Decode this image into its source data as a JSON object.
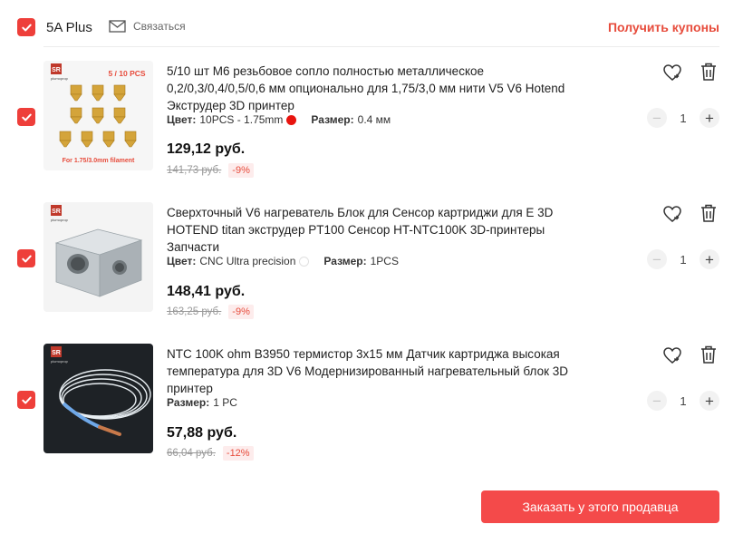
{
  "header": {
    "store_name": "5A Plus",
    "contact_label": "Связаться",
    "coupons_label": "Получить купоны"
  },
  "items": [
    {
      "title": "5/10 шт M6 резьбовое сопло полностью металлическое 0,2/0,3/0,4/0,5/0,6 мм опционально для 1,75/3,0 мм нити V5 V6 Hotend Экструдер 3D принтер",
      "color_label": "Цвет:",
      "color_value": "10PCS - 1.75mm",
      "color_swatch": "#e8140f",
      "size_label": "Размер:",
      "size_value": "0.4 мм",
      "price": "129,12 руб.",
      "old_price": "141,73 руб.",
      "discount": "-9%",
      "quantity": "1",
      "image_badge": "5 / 10 PCS",
      "image_caption": "For 1.75/3.0mm filament",
      "image_brand": "plumoprop",
      "image_logo": "SR"
    },
    {
      "title": "Сверхточный V6 нагреватель Блок для Сенсор картриджи для E 3D HOTEND titan экструдер PT100 Сенсор HT-NTC100K 3D-принтеры Запчасти",
      "color_label": "Цвет:",
      "color_value": "CNC Ultra precision",
      "color_swatch": "#ffffff",
      "size_label": "Размер:",
      "size_value": "1PCS",
      "price": "148,41 руб.",
      "old_price": "163,25 руб.",
      "discount": "-9%",
      "quantity": "1",
      "image_brand": "plumoprop",
      "image_logo": "SR"
    },
    {
      "title": "NTC 100K ohm B3950 термистор 3x15 мм Датчик картриджа высокая температура для 3D V6 Модернизированный нагревательный блок 3D принтер",
      "size_label": "Размер:",
      "size_value": "1 PC",
      "price": "57,88 руб.",
      "old_price": "66,04 руб.",
      "discount": "-12%",
      "quantity": "1",
      "image_brand": "plumoprop",
      "image_logo": "SR"
    }
  ],
  "order_button_label": "Заказать у этого продавца",
  "colors": {
    "accent": "#ee3f3a",
    "button": "#f44a4a"
  },
  "icons": [
    "checkbox-checked-icon",
    "mail-icon",
    "heart-icon",
    "trash-icon",
    "minus-icon",
    "plus-icon"
  ]
}
